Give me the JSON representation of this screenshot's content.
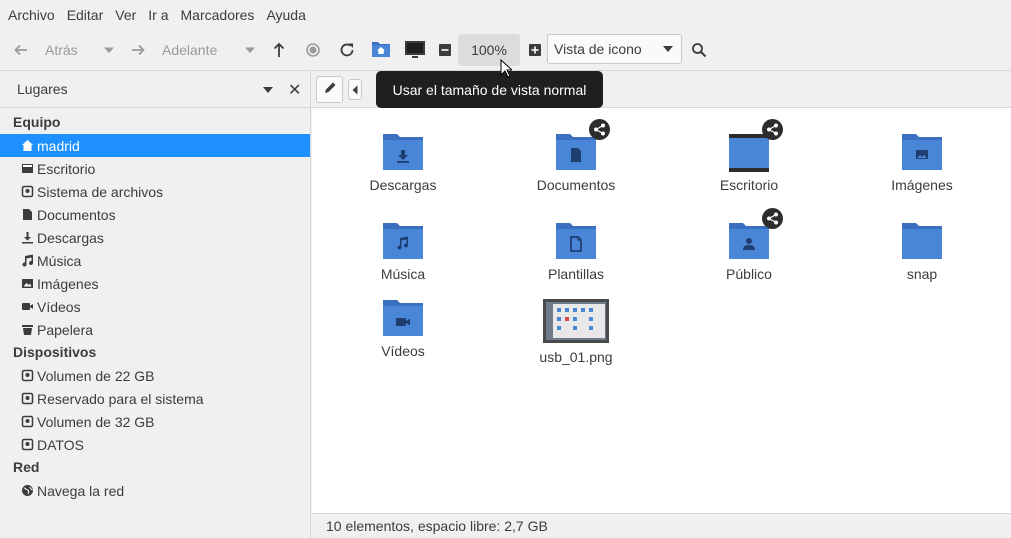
{
  "menubar": {
    "items": [
      "Archivo",
      "Editar",
      "Ver",
      "Ir a",
      "Marcadores",
      "Ayuda"
    ]
  },
  "toolbar": {
    "back_label": "Atrás",
    "forward_label": "Adelante",
    "zoom": "100%",
    "view_mode": "Vista de icono"
  },
  "tooltip": "Usar el tamaño de vista normal",
  "sidebar": {
    "title": "Lugares",
    "sections": {
      "equipo": "Equipo",
      "dispositivos": "Dispositivos",
      "red": "Red"
    },
    "equipo_items": [
      {
        "label": "madrid",
        "icon": "home-icon",
        "active": true
      },
      {
        "label": "Escritorio",
        "icon": "desktop-icon"
      },
      {
        "label": "Sistema de archivos",
        "icon": "drive-icon"
      },
      {
        "label": "Documentos",
        "icon": "document-icon"
      },
      {
        "label": "Descargas",
        "icon": "download-icon"
      },
      {
        "label": "Música",
        "icon": "music-icon"
      },
      {
        "label": "Imágenes",
        "icon": "image-icon"
      },
      {
        "label": "Vídeos",
        "icon": "video-icon"
      },
      {
        "label": "Papelera",
        "icon": "trash-icon"
      }
    ],
    "dispositivos_items": [
      {
        "label": "Volumen de 22 GB",
        "icon": "drive-icon"
      },
      {
        "label": "Reservado para el sistema",
        "icon": "drive-icon"
      },
      {
        "label": "Volumen de 32 GB",
        "icon": "drive-icon"
      },
      {
        "label": "DATOS",
        "icon": "drive-icon"
      }
    ],
    "red_items": [
      {
        "label": "Navega la red",
        "icon": "network-icon"
      }
    ]
  },
  "files": [
    {
      "label": "Descargas",
      "icon": "download-icon",
      "shared": false
    },
    {
      "label": "Documentos",
      "icon": "document-icon",
      "shared": true
    },
    {
      "label": "Escritorio",
      "icon": "desktop-icon",
      "shared": true
    },
    {
      "label": "Imágenes",
      "icon": "image-icon",
      "shared": false
    },
    {
      "label": "Música",
      "icon": "music-icon",
      "shared": false
    },
    {
      "label": "Plantillas",
      "icon": "template-icon",
      "shared": false
    },
    {
      "label": "Público",
      "icon": "user-icon",
      "shared": true
    },
    {
      "label": "snap",
      "icon": "folder-icon",
      "shared": false
    },
    {
      "label": "Vídeos",
      "icon": "video-icon",
      "shared": false
    },
    {
      "label": "usb_01.png",
      "icon": "image-thumbnail",
      "shared": false
    }
  ],
  "status": "10 elementos, espacio libre: 2,7 GB",
  "colors": {
    "accent": "#1e90ff",
    "folder": "#4a86d8",
    "folder_dark": "#3a70bf"
  }
}
